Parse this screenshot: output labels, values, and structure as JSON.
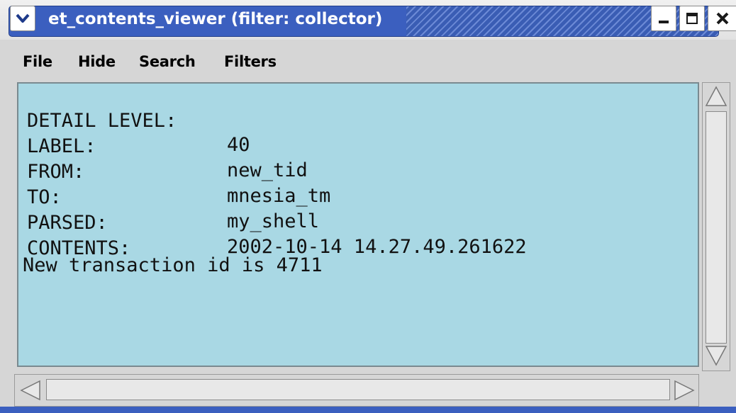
{
  "window": {
    "title": "et_contents_viewer (filter: collector)",
    "accent_color": "#3b5fbf",
    "icons": {
      "menu": "chevron-down-icon",
      "minimize": "minimize-icon",
      "maximize": "maximize-icon",
      "close": "close-icon"
    }
  },
  "menubar": {
    "file": "File",
    "hide": "Hide",
    "search": "Search",
    "filters": "Filters"
  },
  "content": {
    "background_color": "#a9d8e4",
    "fields": [
      {
        "label": "DETAIL LEVEL:",
        "value": "40"
      },
      {
        "label": "LABEL:",
        "value": "new_tid"
      },
      {
        "label": "FROM:",
        "value": "mnesia_tm"
      },
      {
        "label": "TO:",
        "value": "my_shell"
      },
      {
        "label": "PARSED:",
        "value": "2002-10-14 14.27.49.261622"
      },
      {
        "label": "CONTENTS:",
        "value": ""
      }
    ],
    "body_text": "New transaction id is 4711"
  }
}
